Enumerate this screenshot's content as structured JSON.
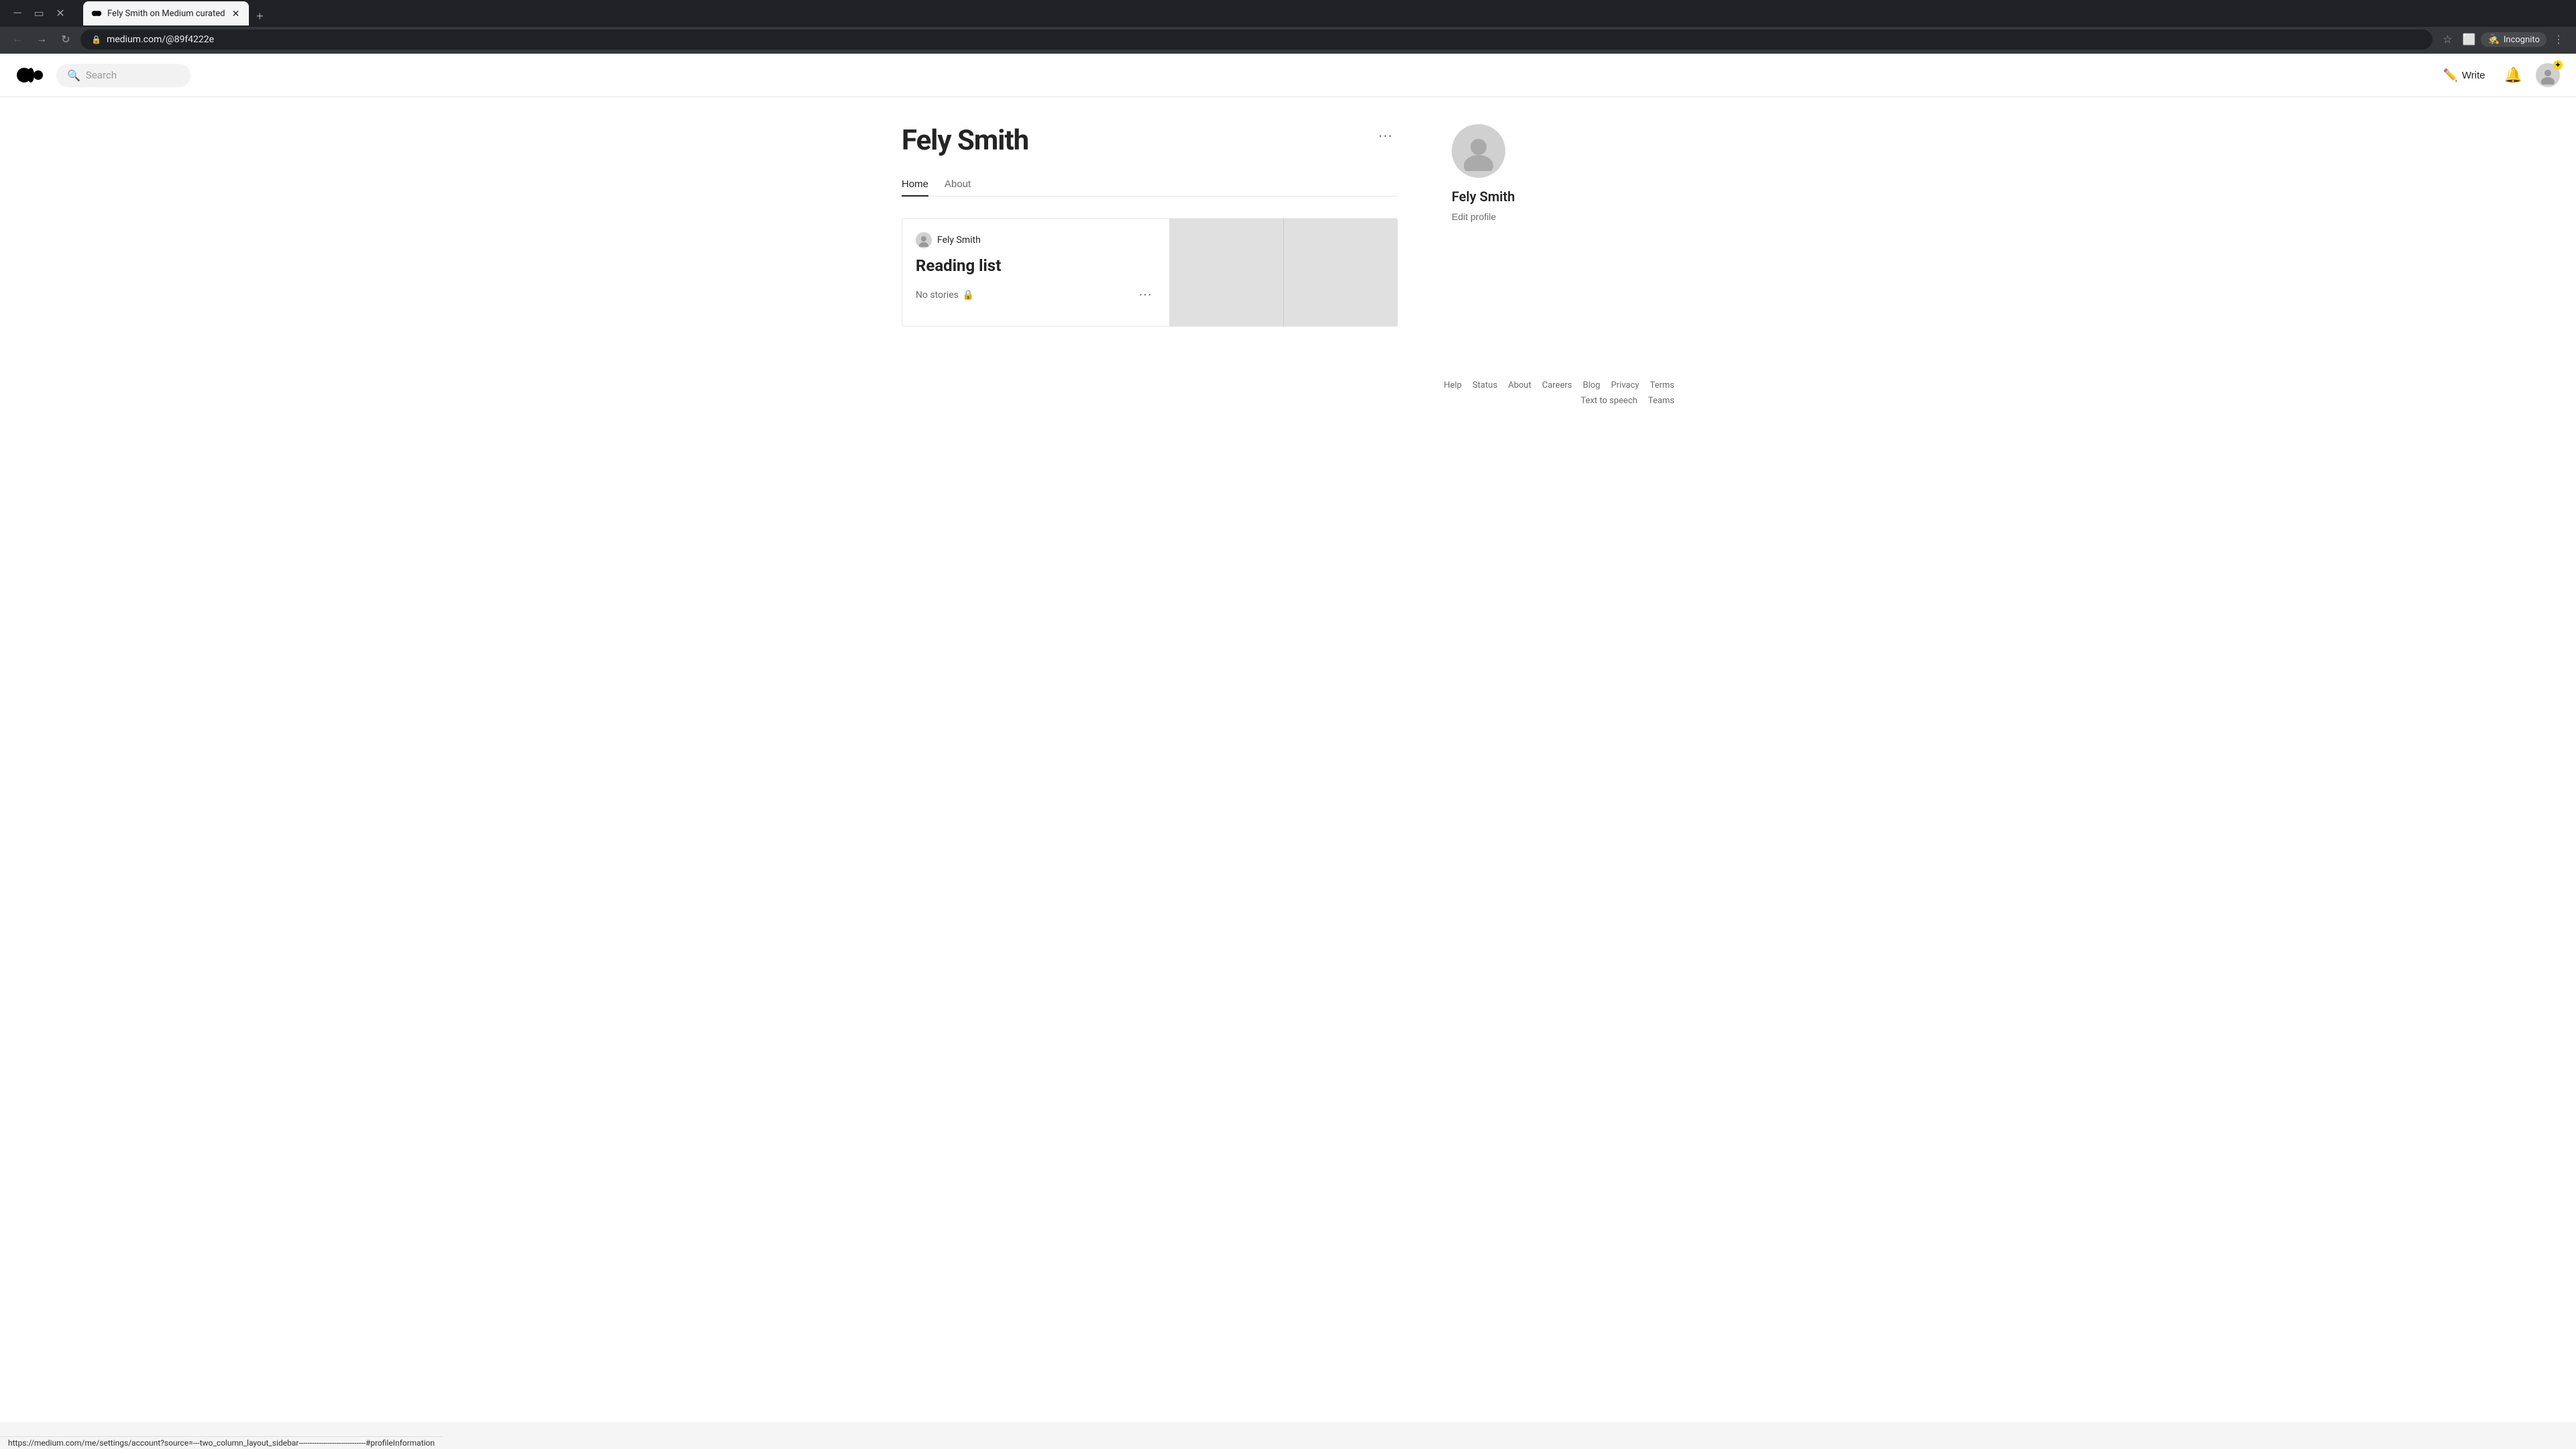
{
  "browser": {
    "tab_title": "Fely Smith on Medium curated",
    "tab_favicon": "M",
    "url": "medium.com/@89f4222e",
    "incognito_label": "Incognito",
    "new_tab_label": "+"
  },
  "header": {
    "search_placeholder": "Search",
    "write_label": "Write",
    "logo_alt": "Medium"
  },
  "profile": {
    "name": "Fely Smith",
    "tabs": [
      {
        "label": "Home",
        "active": true
      },
      {
        "label": "About",
        "active": false
      }
    ],
    "more_dots": "···"
  },
  "reading_list": {
    "author": "Fely Smith",
    "title": "Reading list",
    "no_stories": "No stories",
    "more_dots": "···"
  },
  "sidebar": {
    "name": "Fely Smith",
    "edit_profile": "Edit profile"
  },
  "footer": {
    "links": [
      "Help",
      "Status",
      "About",
      "Careers",
      "Blog",
      "Privacy",
      "Terms",
      "Text to speech",
      "Teams"
    ]
  },
  "statusbar": {
    "url": "https://medium.com/me/settings/account?source=---two_column_layout_sidebar------------------------------#profileInformation"
  }
}
